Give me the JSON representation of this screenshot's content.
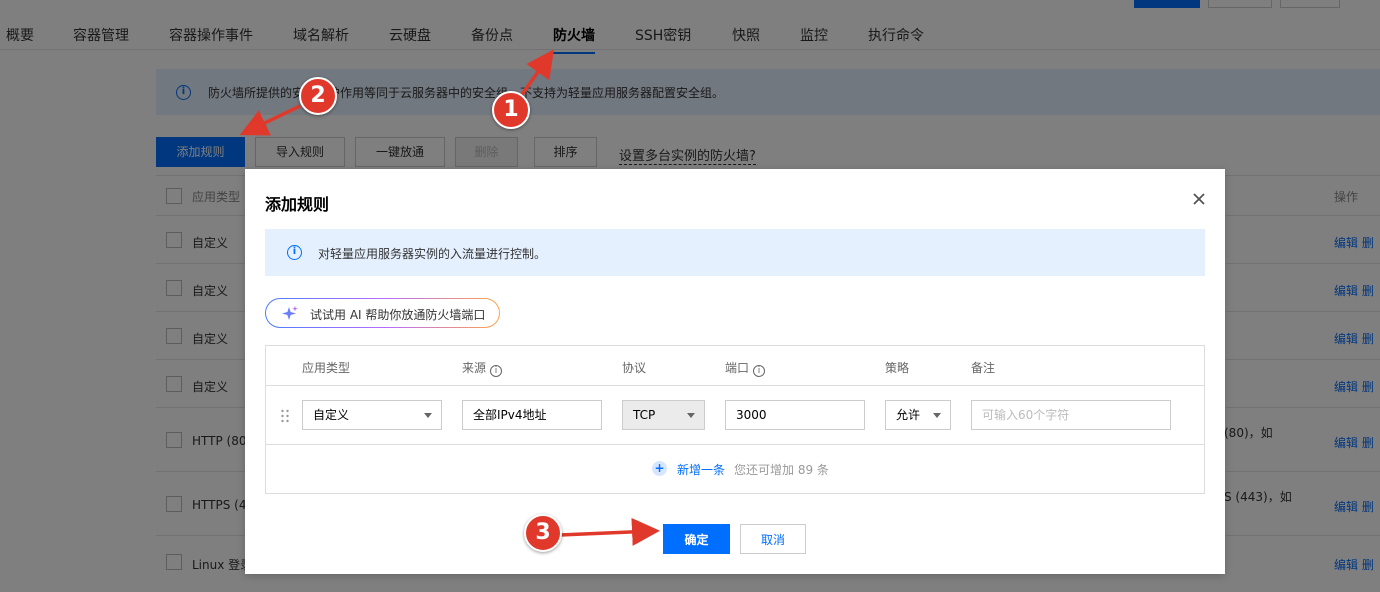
{
  "tabs": [
    {
      "label": "概要"
    },
    {
      "label": "容器管理"
    },
    {
      "label": "容器操作事件"
    },
    {
      "label": "域名解析"
    },
    {
      "label": "云硬盘"
    },
    {
      "label": "备份点"
    },
    {
      "label": "防火墙"
    },
    {
      "label": "SSH密钥"
    },
    {
      "label": "快照"
    },
    {
      "label": "监控"
    },
    {
      "label": "执行命令"
    }
  ],
  "active_tab": "防火墙",
  "info_bar": {
    "text": "防火墙所提供的安全保护作用等同于云服务器中的安全组，不支持为轻量应用服务器配置安全组。"
  },
  "toolbar": {
    "add_rule": "添加规则",
    "import_rules": "导入规则",
    "one_click_allow": "一键放通",
    "delete": "删除",
    "sort": "排序",
    "multi_instance_link": "设置多台实例的防火墙?"
  },
  "bg_table": {
    "header": {
      "type": "应用类型",
      "ops": "操作"
    },
    "rows": [
      {
        "type": "自定义",
        "ops": "编辑  删",
        "note": ""
      },
      {
        "type": "自定义",
        "ops": "编辑  删",
        "note": ""
      },
      {
        "type": "自定义",
        "ops": "编辑  删",
        "note": ""
      },
      {
        "type": "自定义",
        "ops": "编辑  删",
        "note": ""
      },
      {
        "type": "HTTP (80",
        "ops": "编辑  删",
        "note": "(80)，如"
      },
      {
        "type": "HTTPS (4",
        "ops": "编辑  删",
        "note": "S (443)，如"
      },
      {
        "type": "Linux 登录",
        "ops": "编辑  删",
        "note": ""
      }
    ]
  },
  "dialog": {
    "title": "添加规则",
    "info": "对轻量应用服务器实例的入流量进行控制。",
    "ai_button": "试试用 AI 帮助你放通防火墙端口",
    "columns": {
      "type": "应用类型",
      "source": "来源",
      "protocol": "协议",
      "port": "端口",
      "policy": "策略",
      "note": "备注"
    },
    "row": {
      "type": "自定义",
      "source": "全部IPv4地址",
      "protocol": "TCP",
      "port": "3000",
      "policy": "允许",
      "note_placeholder": "可输入60个字符"
    },
    "add_link": "新增一条",
    "add_hint": "您还可增加 89 条",
    "ok": "确定",
    "cancel": "取消"
  },
  "annotations": {
    "badge1": "1",
    "badge2": "2",
    "badge3": "3",
    "color": "#e0392b"
  }
}
